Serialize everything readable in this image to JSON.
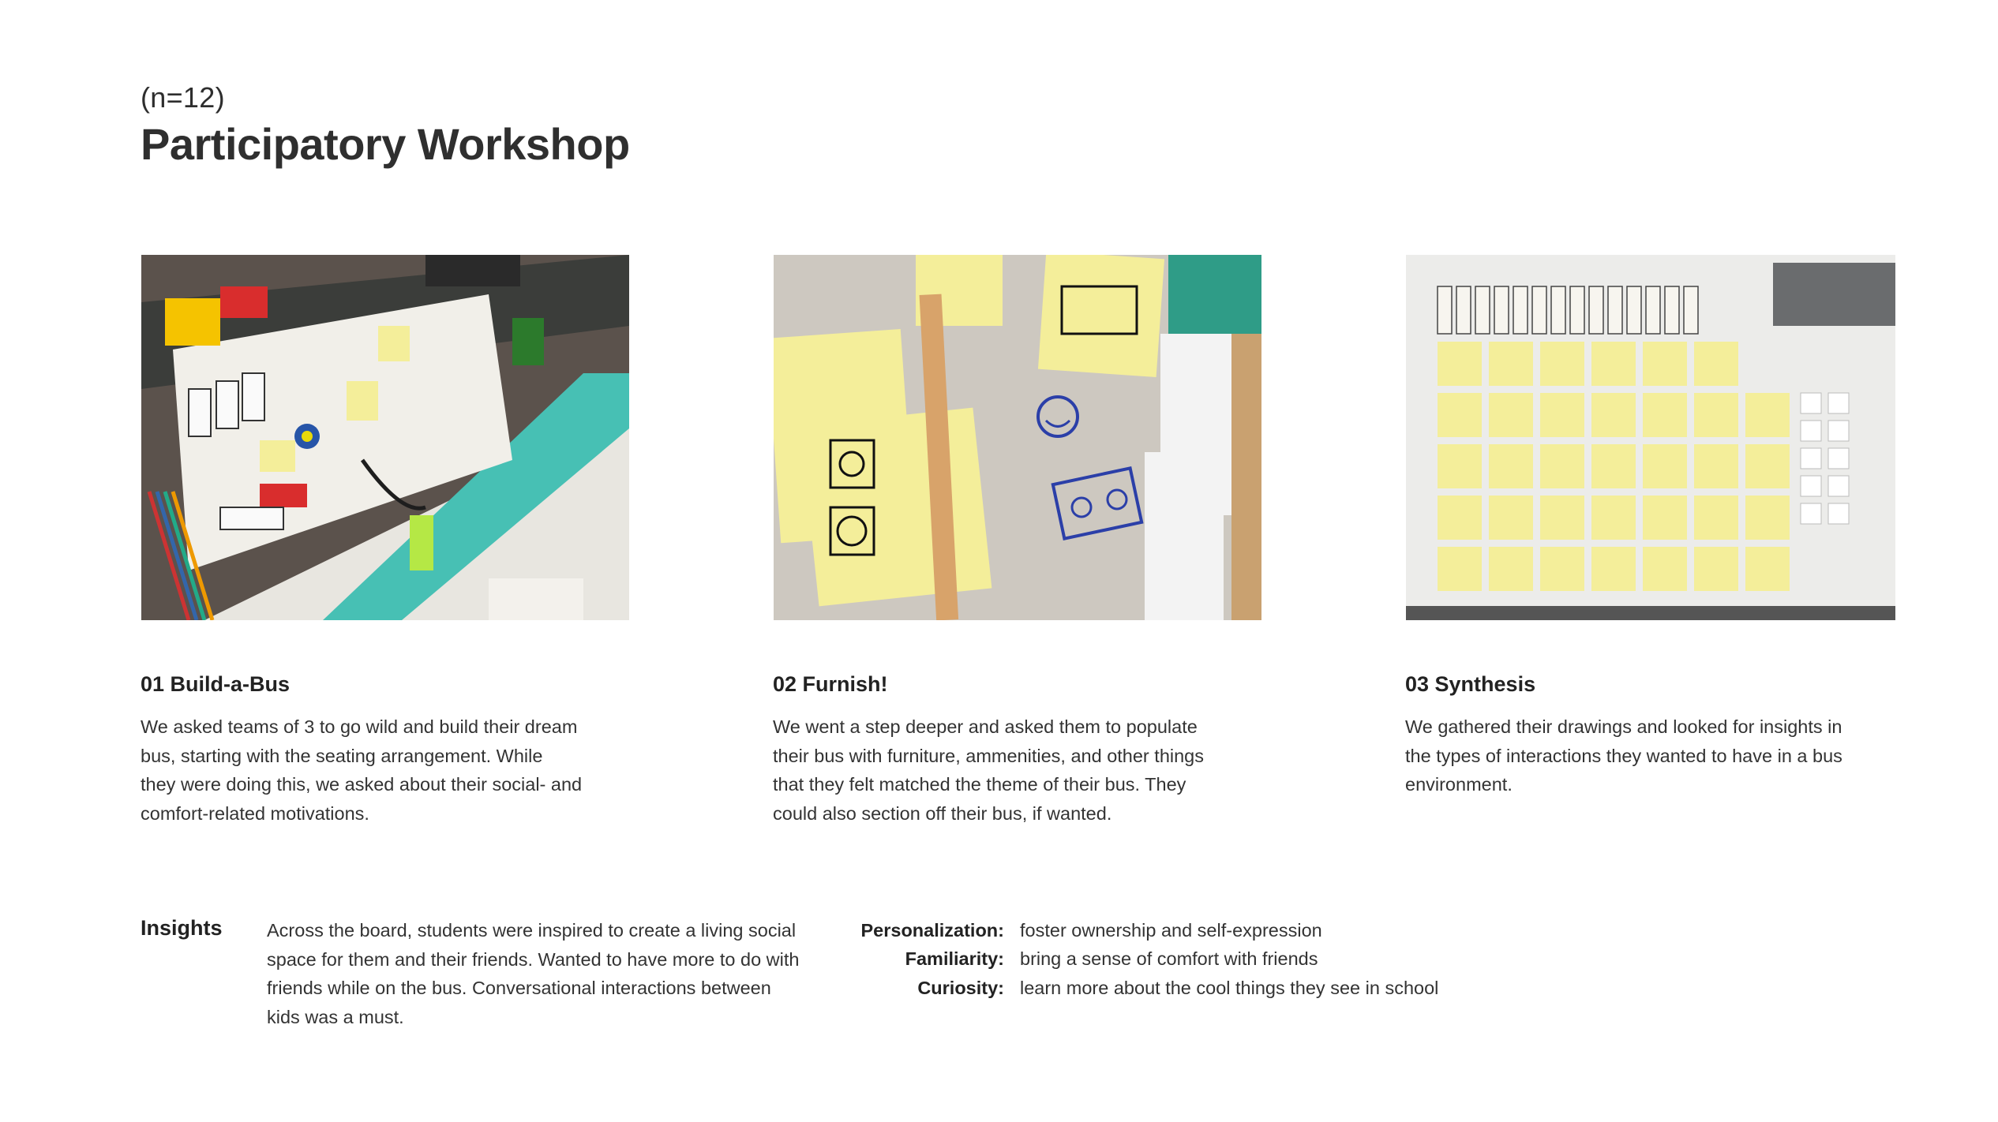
{
  "header": {
    "subtitle": "(n=12)",
    "title": "Participatory Workshop"
  },
  "steps": [
    {
      "title": "01 Build-a-Bus",
      "body": "We asked teams of 3 to go wild and build their dream bus, starting with the seating arrangement. While they were doing this, we asked about their social- and comfort-related motivations.",
      "photo_alt": "Students building a bus model with blocks, crayons and pipe cleaners"
    },
    {
      "title": "02 Furnish!",
      "body": "We went a step deeper and asked them to populate their bus with furniture, ammenities, and other things that they felt matched the theme of their bus. They could also section off their bus, if wanted.",
      "photo_alt": "Sticky notes with drawings of a washing machine, TV and a smiling face"
    },
    {
      "title": "03 Synthesis",
      "body": "We gathered their drawings and looked for insights in the types of interactions they wanted to have in a bus environment.",
      "photo_alt": "Grid of yellow sticky notes under a row of block figures on a whiteboard"
    }
  ],
  "insights": {
    "label": "Insights",
    "body": "Across the board, students were inspired to create a living social space for them and their friends. Wanted to have more to do with friends while on the bus. Conversational interactions between kids was a must.",
    "themes": [
      {
        "key": "Personalization:",
        "value": "foster ownership and self-expression"
      },
      {
        "key": "Familiarity:",
        "value": "bring a sense of comfort with friends"
      },
      {
        "key": "Curiosity:",
        "value": "learn more about the cool things they see in school"
      }
    ]
  },
  "colors": {
    "sticky_yellow": "#f4ee9a",
    "teal": "#47c0b4",
    "text": "#2b2b2b"
  }
}
